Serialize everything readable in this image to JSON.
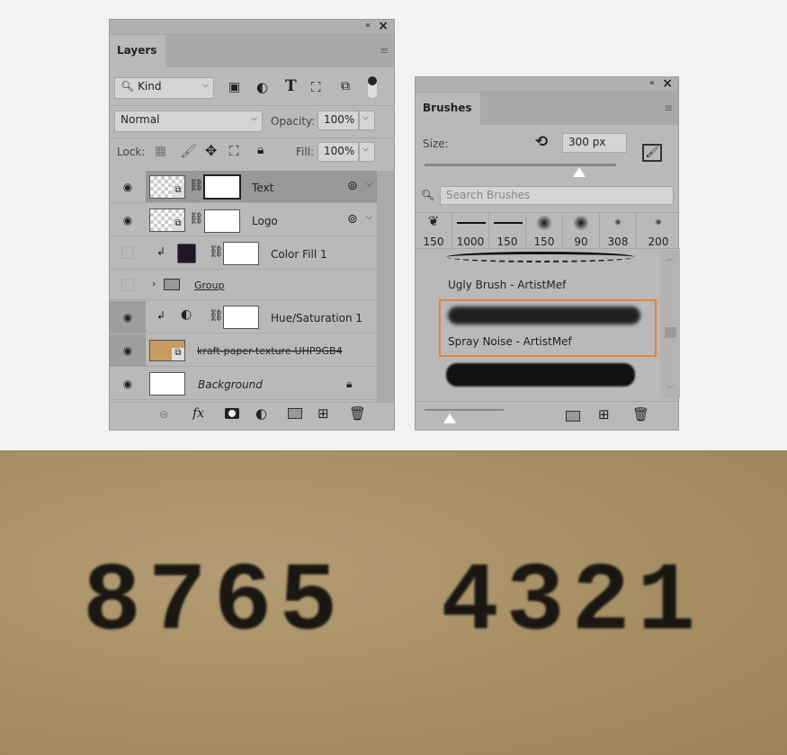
{
  "layers_panel": {
    "tab": "Layers",
    "filter_kind": "Kind",
    "blend_mode": "Normal",
    "opacity_label": "Opacity:",
    "opacity_value": "100%",
    "lock_label": "Lock:",
    "fill_label": "Fill:",
    "fill_value": "100%",
    "layers": [
      {
        "name": "Text",
        "visible": true,
        "selected": true
      },
      {
        "name": "Logo",
        "visible": true
      },
      {
        "name": "Color Fill 1",
        "visible": false,
        "fill_color": "#1e1826"
      },
      {
        "name": "Group",
        "visible": false
      },
      {
        "name": "Hue/Saturation 1",
        "visible": true
      },
      {
        "name": "kraft-paper-texture-UHP9GB4",
        "visible": true
      },
      {
        "name": "Background",
        "visible": true,
        "locked": true
      }
    ],
    "footer_fx": "fx"
  },
  "brushes_panel": {
    "tab": "Brushes",
    "size_label": "Size:",
    "size_value": "300 px",
    "size_fraction": 0.8,
    "search_placeholder": "Search Brushes",
    "presets": [
      "150",
      "1000",
      "150",
      "150",
      "90",
      "308",
      "200"
    ],
    "brushes": [
      {
        "name": "Ugly Brush - ArtistMef"
      },
      {
        "name": "Spray Noise - ArtistMef",
        "selected": true
      }
    ],
    "selection_color": "#e8823a"
  },
  "image": {
    "left_digits": "8765",
    "right_digits": "4321"
  }
}
